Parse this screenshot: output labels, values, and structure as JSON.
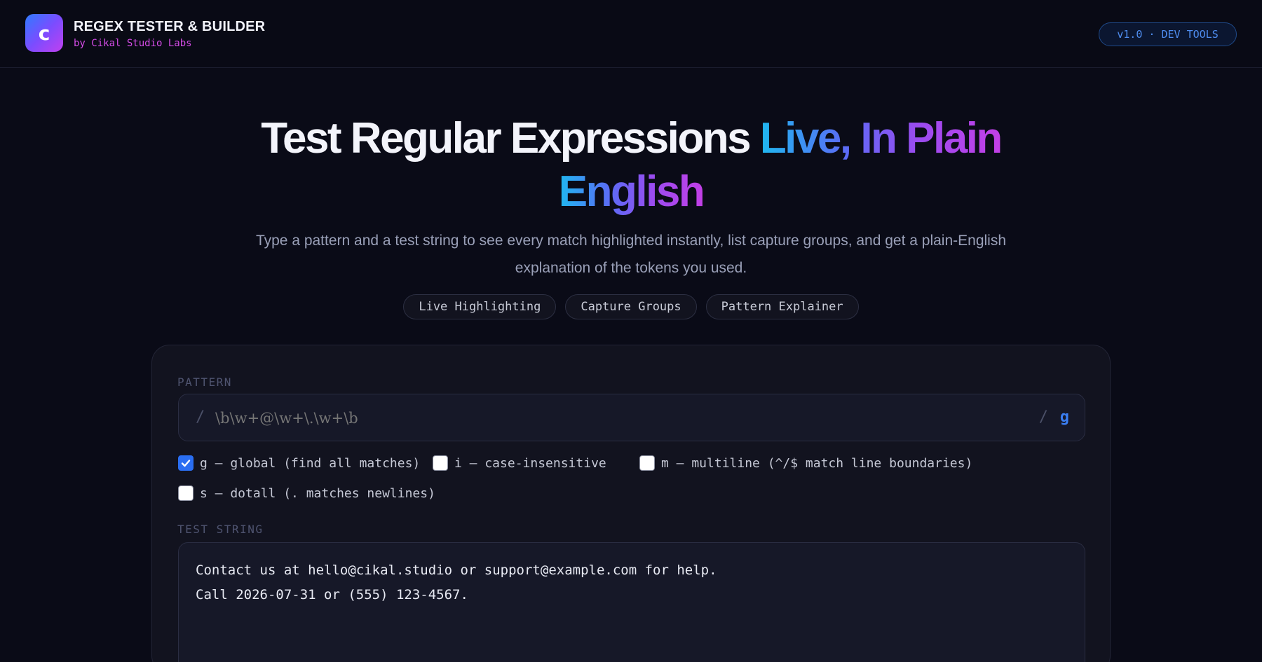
{
  "header": {
    "logo_letter": "c",
    "title": "REGEX TESTER & BUILDER",
    "subtitle": "by Cikal Studio Labs",
    "version_badge": "v1.0 · DEV TOOLS"
  },
  "hero": {
    "title_plain": "Test Regular Expressions ",
    "title_gradient_line1": "Live, In Plain",
    "title_gradient_line2": "English",
    "description_line1": "Type a pattern and a test string to see every match highlighted instantly, list capture groups, and get a plain-English",
    "description_line2": "explanation of the tokens you used.",
    "pills": [
      "Live Highlighting",
      "Capture Groups",
      "Pattern Explainer"
    ]
  },
  "panel": {
    "pattern_label": "PATTERN",
    "pattern_open_slash": "/",
    "pattern_close_slash": "/",
    "pattern_placeholder": "\\b\\w+@\\w+\\.\\w+\\b",
    "pattern_value": "",
    "active_flags": "g",
    "flags": [
      {
        "label": "g — global (find all matches)",
        "checked": true
      },
      {
        "label": "i — case-insensitive",
        "checked": false
      },
      {
        "label": "m — multiline (^/$ match line boundaries)",
        "checked": false
      },
      {
        "label": "s — dotall (. matches newlines)",
        "checked": false
      }
    ],
    "test_label": "TEST STRING",
    "test_lines": [
      "Contact us at hello@cikal.studio or support@example.com for help.",
      "Call 2026-07-31 or (555) 123-4567."
    ]
  },
  "colors": {
    "background": "#0a0b17",
    "accent_blue": "#2a6ef2",
    "accent_pink": "#d64ce8"
  }
}
